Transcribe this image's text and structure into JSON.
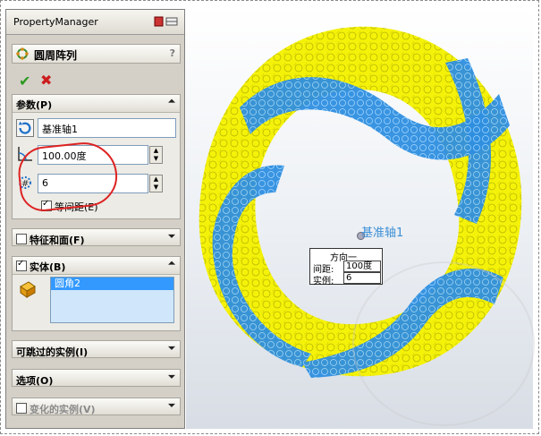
{
  "panel": {
    "title": "PropertyManager",
    "feature_name": "圆周阵列",
    "help": "?",
    "ok_icon": "check-icon",
    "cancel_icon": "x-icon"
  },
  "params": {
    "header": "参数(P)",
    "axis_value": "基准轴1",
    "angle_value": "100.00度",
    "count_value": "6",
    "equal_spacing_label": "等间距(E)",
    "equal_spacing_checked": true
  },
  "sections": {
    "features_faces": "特征和面(F)",
    "bodies": "实体(B)",
    "bodies_item": "圆角2",
    "skippable": "可跳过的实例(I)",
    "options": "选项(O)",
    "varied": "变化的实例(V)"
  },
  "graphics": {
    "axis_label": "基准轴1",
    "callout_title": "方向一",
    "callout_spacing_label": "间距:",
    "callout_spacing_value": "100度",
    "callout_count_label": "实例:",
    "callout_count_value": "6"
  },
  "colors": {
    "ring_yellow": "#f5f20a",
    "ring_blue": "#2f8fe0",
    "highlight_red": "#d22222",
    "accept_green": "#2a9a1e"
  }
}
